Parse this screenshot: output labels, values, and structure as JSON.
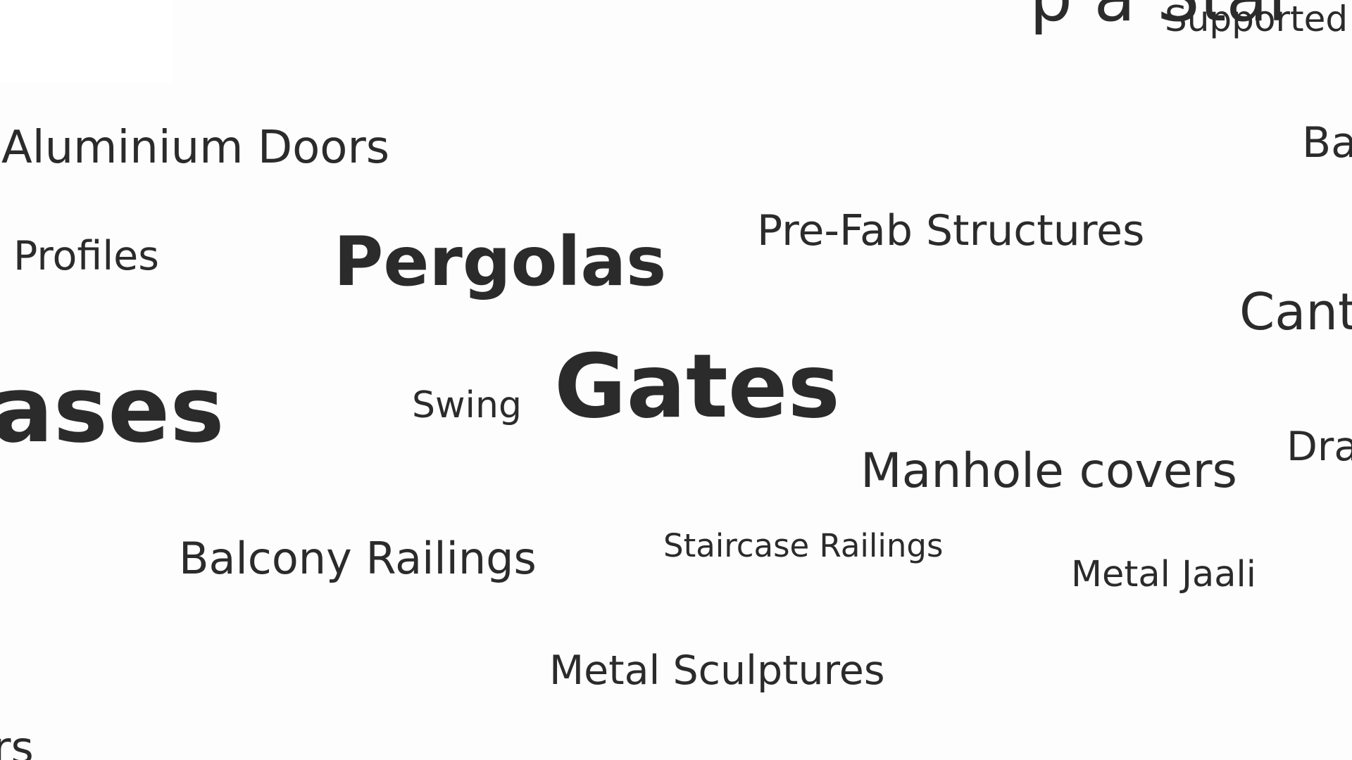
{
  "words": {
    "aluminium_doors": "Aluminium Doors",
    "profiles": "Profiles",
    "pergolas": "Pergolas",
    "prefab_structures": "Pre-Fab Structures",
    "ases": "ases",
    "swing": "Swing",
    "gates": "Gates",
    "manhole_covers": "Manhole covers",
    "balcony_railings": "Balcony Railings",
    "staircase_railings": "Staircase Railings",
    "metal_jaali": "Metal Jaali",
    "metal_sculptures": "Metal Sculptures",
    "rs": "rs",
    "supported": "Supported",
    "top_cut": "p a Stai",
    "ba": "Ba",
    "cant": "Cant",
    "dra": "Dra"
  },
  "colors": {
    "text": "#2b2b2b",
    "background": "#fdfdfd"
  }
}
